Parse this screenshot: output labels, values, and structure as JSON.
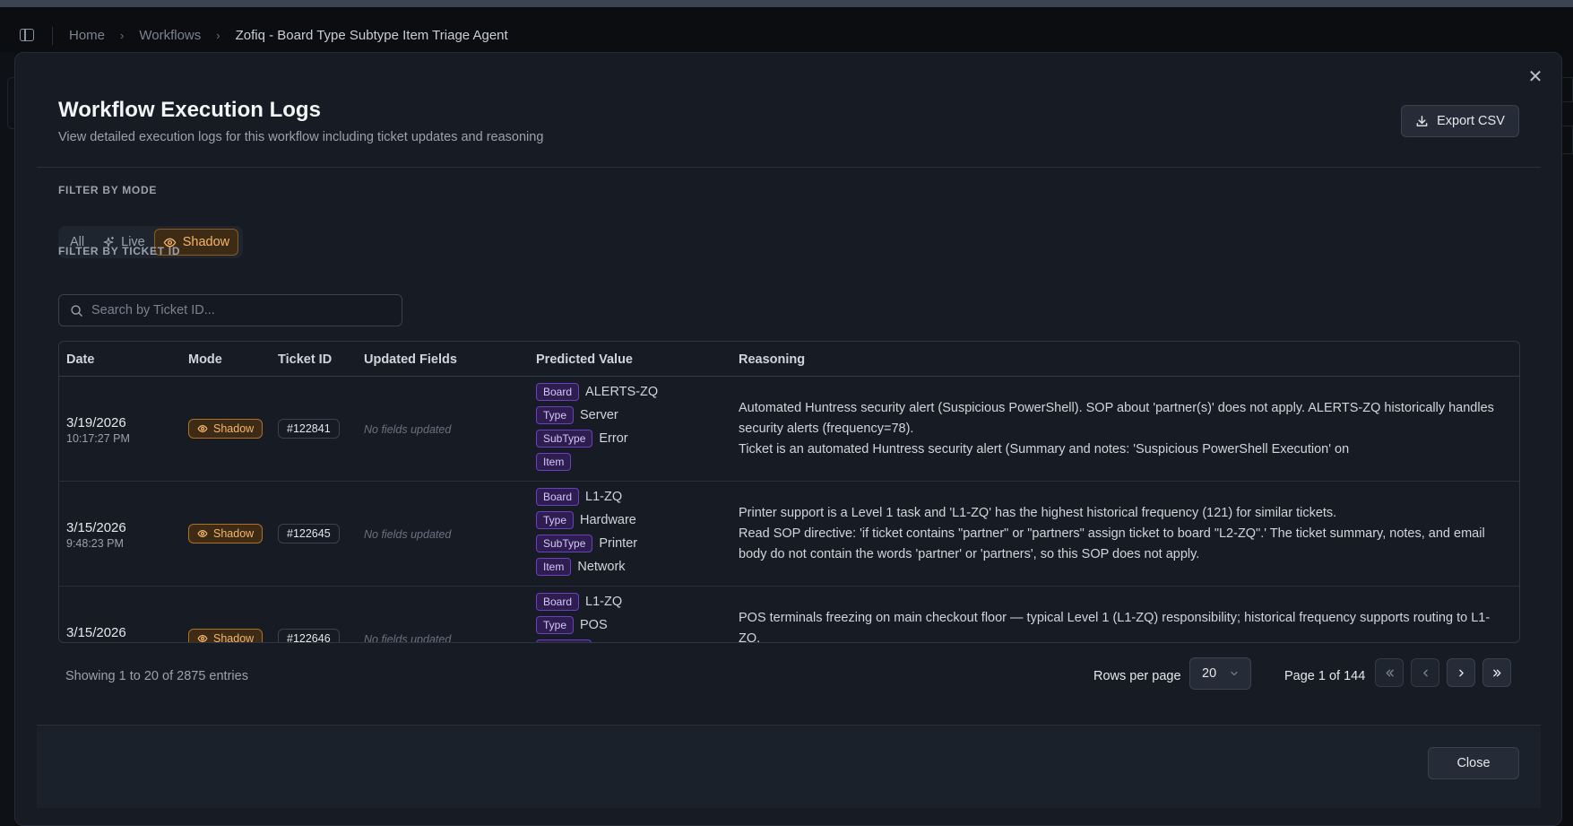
{
  "breadcrumb": {
    "home": "Home",
    "workflows": "Workflows",
    "current": "Zofiq - Board Type Subtype Item Triage Agent"
  },
  "modal": {
    "title": "Workflow Execution Logs",
    "subtitle": "View detailed execution logs for this workflow including ticket updates and reasoning",
    "export_label": "Export CSV",
    "close_label": "Close"
  },
  "filters": {
    "mode_label": "FILTER BY MODE",
    "modes": [
      "All",
      "Live",
      "Shadow"
    ],
    "active_mode": "Shadow",
    "ticket_label": "FILTER BY TICKET ID",
    "search_placeholder": "Search by Ticket ID..."
  },
  "table": {
    "columns": [
      "Date",
      "Mode",
      "Ticket ID",
      "Updated Fields",
      "Predicted Value",
      "Reasoning"
    ],
    "rows": [
      {
        "date": "3/19/2026",
        "time": "10:17:27 PM",
        "mode": "Shadow",
        "ticket": "#122841",
        "updated": "No fields updated",
        "predicted": [
          {
            "tag": "Board",
            "value": "ALERTS-ZQ"
          },
          {
            "tag": "Type",
            "value": "Server"
          },
          {
            "tag": "SubType",
            "value": "Error"
          },
          {
            "tag": "Item",
            "value": ""
          }
        ],
        "reasoning": [
          "Automated Huntress security alert (Suspicious PowerShell). SOP about 'partner(s)' does not apply. ALERTS-ZQ historically handles security alerts (frequency=78).",
          "Ticket is an automated Huntress security alert (Summary and notes: 'Suspicious PowerShell Execution' on"
        ]
      },
      {
        "date": "3/15/2026",
        "time": "9:48:23 PM",
        "mode": "Shadow",
        "ticket": "#122645",
        "updated": "No fields updated",
        "predicted": [
          {
            "tag": "Board",
            "value": "L1-ZQ"
          },
          {
            "tag": "Type",
            "value": "Hardware"
          },
          {
            "tag": "SubType",
            "value": "Printer"
          },
          {
            "tag": "Item",
            "value": "Network"
          }
        ],
        "reasoning": [
          "Printer support is a Level 1 task and 'L1-ZQ' has the highest historical frequency (121) for similar tickets.",
          "Read SOP directive: 'if ticket contains \"partner\" or \"partners\" assign ticket to board \"L2-ZQ\".' The ticket summary, notes, and email body do not contain the words 'partner' or 'partners', so this SOP does not apply."
        ]
      },
      {
        "date": "3/15/2026",
        "time": "",
        "mode": "Shadow",
        "ticket": "#122646",
        "updated": "No fields updated",
        "predicted": [
          {
            "tag": "Board",
            "value": "L1-ZQ"
          },
          {
            "tag": "Type",
            "value": "POS"
          }
        ],
        "reasoning": [
          "POS terminals freezing on main checkout floor — typical Level 1 (L1-ZQ) responsibility; historical frequency supports routing to L1-ZQ."
        ]
      }
    ]
  },
  "pagination": {
    "showing": "Showing 1 to 20 of 2875 entries",
    "rows_per_page_label": "Rows per page",
    "rows_per_page": "20",
    "page_label": "Page 1 of 144"
  },
  "icons": {
    "mode_live": "sparkle-icon",
    "mode_shadow": "eye-icon",
    "export": "download-icon",
    "search": "search-icon"
  },
  "colors": {
    "shadow_accent": "#f6b66a",
    "tag_purple": "#6b3fc4",
    "modal_bg": "#161b24"
  }
}
